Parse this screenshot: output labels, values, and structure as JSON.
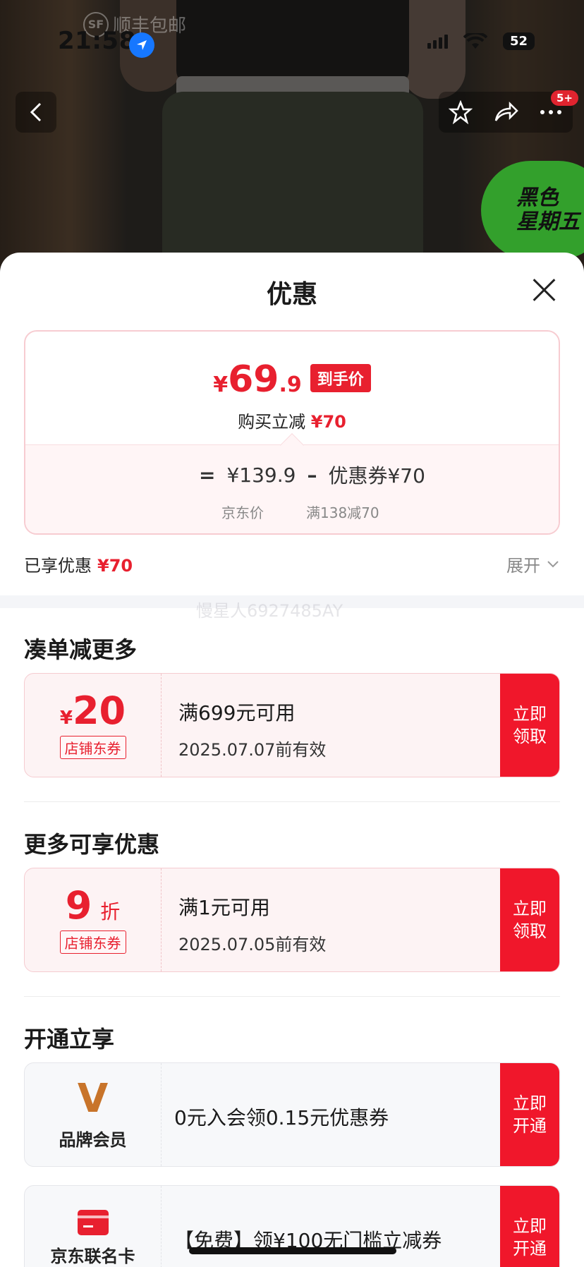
{
  "status_bar": {
    "time": "21:58",
    "battery": "52"
  },
  "watermark_top": {
    "sf": "SF",
    "text": "顺丰包邮"
  },
  "promo": {
    "line1": "黑色",
    "line2": "星期五"
  },
  "nav": {
    "badge": "5+"
  },
  "sheet": {
    "title": "优惠",
    "price": {
      "yen": "¥",
      "integer": "69",
      "decimal": ".9",
      "tag": "到手价",
      "reduce_label": "购买立减",
      "reduce_value": "¥70",
      "equals": "=",
      "jd_price": "¥139.9",
      "minus": "–",
      "coupon_label": "优惠券¥70",
      "jd_price_label": "京东价",
      "coupon_condition": "满138减70"
    },
    "enjoyed_label": "已享优惠",
    "enjoyed_value": "¥70",
    "expand_label": "展开",
    "watermark": "慢星人6927485AY"
  },
  "sections": {
    "more_discount": {
      "title": "凑单减更多",
      "coupon": {
        "yen": "¥",
        "amount": "20",
        "tag": "店铺东券",
        "condition": "满699元可用",
        "date": "2025.07.07前有效",
        "button": "立即领取"
      }
    },
    "more_offers": {
      "title": "更多可享优惠",
      "coupon": {
        "amount": "9",
        "unit": "折",
        "tag": "店铺东券",
        "condition": "满1元可用",
        "date": "2025.07.05前有效",
        "button": "立即领取"
      }
    },
    "open_enjoy": {
      "title": "开通立享",
      "brand_member": {
        "logo": "V",
        "label": "品牌会员",
        "text": "0元入会领0.15元优惠券",
        "button": "立即开通"
      },
      "jd_card": {
        "label": "京东联名卡",
        "text": "【免费】领¥100无门槛立减券",
        "button": "立即开通"
      }
    }
  },
  "colors": {
    "accent_red": "#e8202f",
    "button_red": "#f0172b",
    "promo_green": "#33a02c"
  }
}
